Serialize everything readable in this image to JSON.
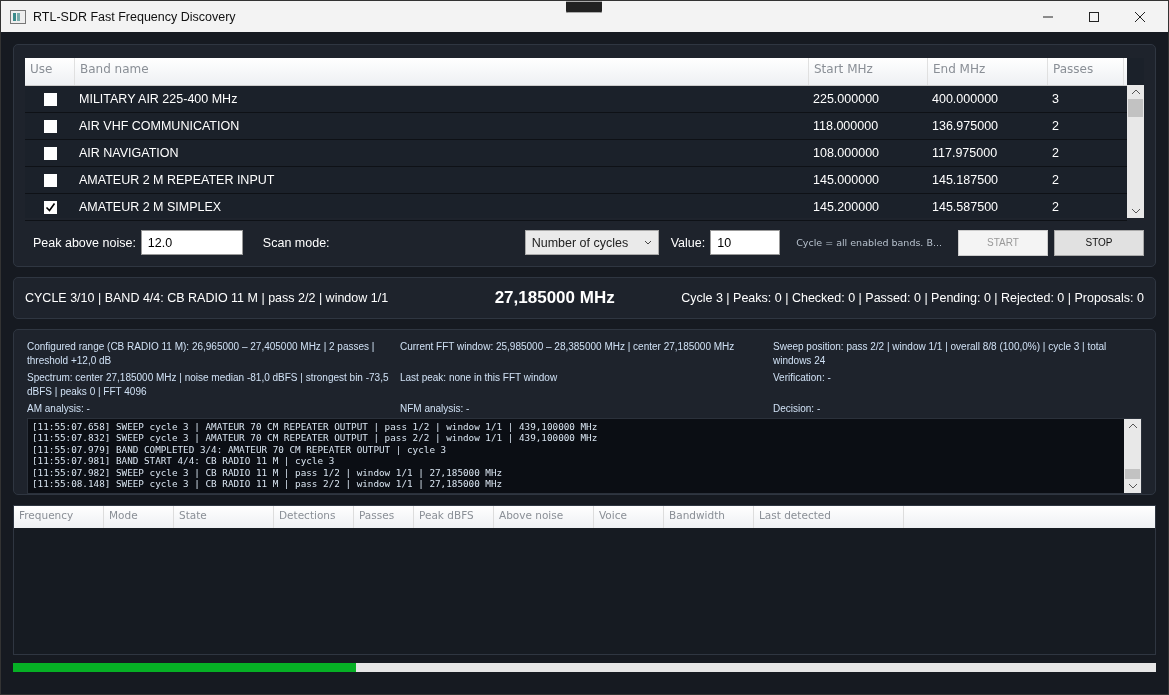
{
  "window": {
    "title": "RTL-SDR Fast Frequency Discovery"
  },
  "bands": {
    "columns": [
      "Use",
      "Band name",
      "Start MHz",
      "End MHz",
      "Passes"
    ],
    "rows": [
      {
        "use": false,
        "name": "MILITARY AIR 225-400 MHz",
        "start": "225.000000",
        "end": "400.000000",
        "passes": "3"
      },
      {
        "use": false,
        "name": "AIR VHF COMMUNICATION",
        "start": "118.000000",
        "end": "136.975000",
        "passes": "2"
      },
      {
        "use": false,
        "name": "AIR NAVIGATION",
        "start": "108.000000",
        "end": "117.975000",
        "passes": "2"
      },
      {
        "use": false,
        "name": "AMATEUR 2 M REPEATER INPUT",
        "start": "145.000000",
        "end": "145.187500",
        "passes": "2"
      },
      {
        "use": true,
        "name": "AMATEUR 2 M SIMPLEX",
        "start": "145.200000",
        "end": "145.587500",
        "passes": "2"
      }
    ]
  },
  "controls": {
    "peak_label": "Peak above noise:",
    "peak_value": "12.0",
    "scan_mode_label": "Scan mode:",
    "scan_mode": "Number of cycles",
    "value_label": "Value:",
    "value": "10",
    "hint": "Cycle = all enabled bands. B...",
    "start": {
      "label": "START",
      "disabled": true
    },
    "stop": {
      "label": "STOP",
      "disabled": false
    }
  },
  "status": {
    "left": "CYCLE 3/10 | BAND 4/4: CB RADIO 11 M | pass 2/2 | window 1/1",
    "frequency": "27,185000 MHz",
    "right": "Cycle 3 | Peaks: 0 | Checked: 0 | Passed: 0 | Pending: 0 | Rejected: 0 | Proposals: 0"
  },
  "info": [
    [
      "Configured range (CB RADIO 11 M): 26,965000 – 27,405000 MHz | 2 passes | threshold +12,0 dB",
      "Current FFT window: 25,985000 – 28,385000 MHz | center 27,185000 MHz",
      "Sweep position: pass 2/2 | window 1/1 | overall 8/8 (100,0%) | cycle 3 | total windows 24"
    ],
    [
      "Spectrum: center 27,185000 MHz | noise median -81,0 dBFS | strongest bin -73,5 dBFS | peaks 0 | FFT 4096",
      "Last peak: none in this FFT window",
      "Verification: -"
    ],
    [
      "AM analysis: -",
      "NFM analysis: -",
      "Decision: -"
    ]
  ],
  "log": [
    "[11:55:07.658] SWEEP cycle 3 | AMATEUR 70 CM REPEATER OUTPUT | pass 1/2 | window 1/1 | 439,100000 MHz",
    "[11:55:07.832] SWEEP cycle 3 | AMATEUR 70 CM REPEATER OUTPUT | pass 2/2 | window 1/1 | 439,100000 MHz",
    "[11:55:07.979] BAND COMPLETED 3/4: AMATEUR 70 CM REPEATER OUTPUT | cycle 3",
    "[11:55:07.981] BAND START 4/4: CB RADIO 11 M | cycle 3",
    "[11:55:07.982] SWEEP cycle 3 | CB RADIO 11 M | pass 1/2 | window 1/1 | 27,185000 MHz",
    "[11:55:08.148] SWEEP cycle 3 | CB RADIO 11 M | pass 2/2 | window 1/1 | 27,185000 MHz"
  ],
  "results": {
    "columns": [
      "Frequency",
      "Mode",
      "State",
      "Detections",
      "Passes",
      "Peak dBFS",
      "Above noise",
      "Voice",
      "Bandwidth",
      "Last detected"
    ]
  },
  "progress": {
    "level": 0.3
  }
}
